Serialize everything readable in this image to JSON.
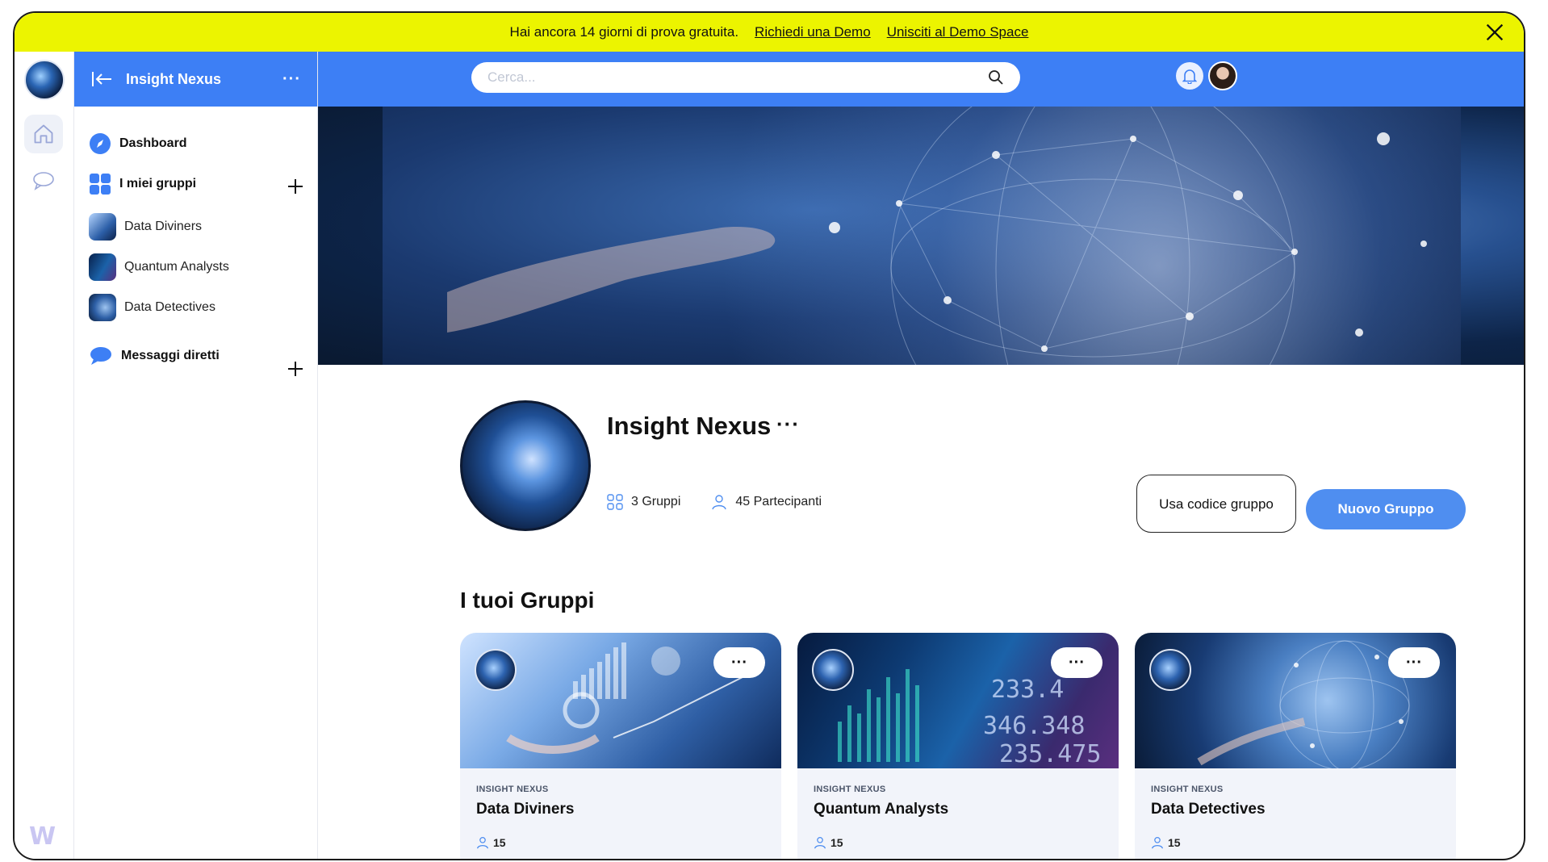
{
  "banner": {
    "text": "Hai ancora 14 giorni di prova gratuita.",
    "demo_link": "Richiedi una Demo",
    "space_link": "Unisciti al Demo Space"
  },
  "sidebar": {
    "title": "Insight Nexus",
    "more": "···",
    "dashboard": "Dashboard",
    "groups_label": "I miei gruppi",
    "groups": [
      {
        "label": "Data Diviners"
      },
      {
        "label": "Quantum Analysts"
      },
      {
        "label": "Data Detectives"
      }
    ],
    "dm_label": "Messaggi diretti"
  },
  "search": {
    "placeholder": "Cerca..."
  },
  "profile": {
    "name": "Insight Nexus",
    "more": "···",
    "groups_count": "3 Gruppi",
    "participants_count": "45 Partecipanti"
  },
  "actions": {
    "code_button": "Usa codice gruppo",
    "new_group_button": "Nuovo Gruppo"
  },
  "groups_section": {
    "title": "I tuoi Gruppi",
    "cards": [
      {
        "kicker": "INSIGHT NEXUS",
        "name": "Data Diviners",
        "members": "15",
        "dots": "···"
      },
      {
        "kicker": "INSIGHT NEXUS",
        "name": "Quantum Analysts",
        "members": "15",
        "dots": "···"
      },
      {
        "kicker": "INSIGHT NEXUS",
        "name": "Data Detectives",
        "members": "15",
        "dots": "···"
      }
    ]
  },
  "colors": {
    "banner": "#ecf400",
    "primary": "#3d7ff5",
    "button_primary": "#4f8ef0",
    "card_bg": "#f2f4fa"
  },
  "icons": {
    "rail": [
      "home-icon",
      "chat-icon"
    ],
    "sidebar": [
      "compass-icon",
      "grid-icon",
      "plus-icon",
      "chat-bubble-icon"
    ],
    "topbar": [
      "search-icon",
      "bell-icon"
    ],
    "banner": [
      "close-icon"
    ]
  }
}
